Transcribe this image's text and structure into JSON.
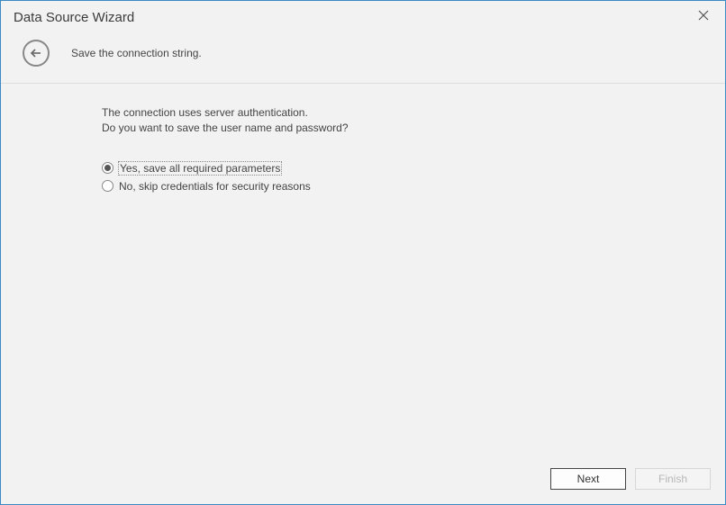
{
  "window": {
    "title": "Data Source Wizard"
  },
  "header": {
    "subtitle": "Save the connection string."
  },
  "content": {
    "desc_line1": "The connection uses server authentication.",
    "desc_line2": "Do you want to save the user name and password?",
    "options": {
      "yes": "Yes, save all required parameters",
      "no": "No, skip credentials for security reasons",
      "selected": "yes"
    }
  },
  "footer": {
    "next": "Next",
    "finish": "Finish"
  }
}
